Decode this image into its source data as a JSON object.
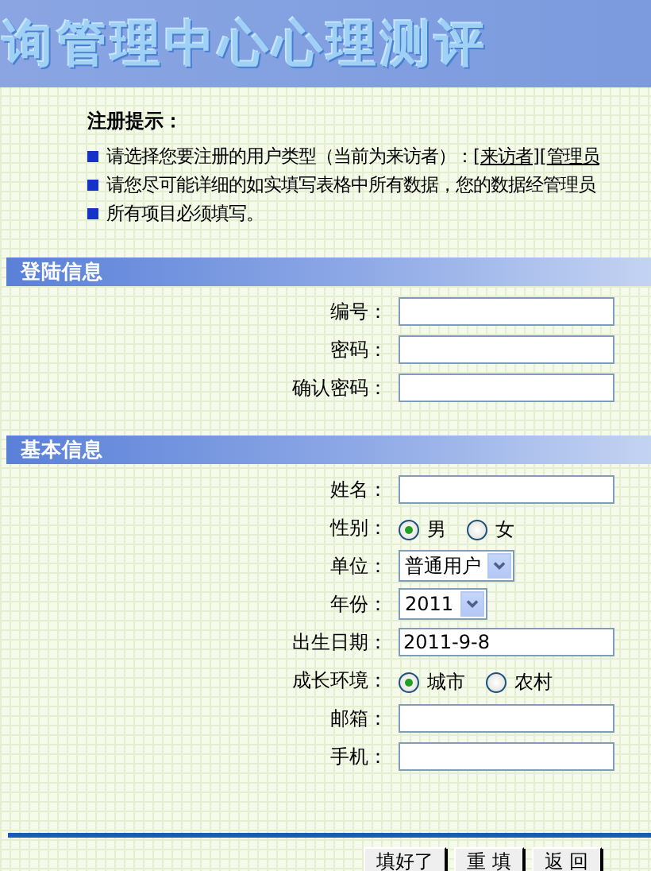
{
  "header": {
    "title": "询管理中心心理测评"
  },
  "tips": {
    "title": "注册提示：",
    "items": [
      {
        "segments": [
          {
            "kind": "text",
            "text": "请选择您要注册的用户类型（当前为来访者）：["
          },
          {
            "kind": "link",
            "text": "来访者"
          },
          {
            "kind": "text",
            "text": "]["
          },
          {
            "kind": "link",
            "text": "管理员"
          }
        ]
      },
      {
        "segments": [
          {
            "kind": "text",
            "text": "请您尽可能详细的如实填写表格中所有数据，您的数据经管理员"
          }
        ]
      },
      {
        "segments": [
          {
            "kind": "text",
            "text": "所有项目必须填写。"
          }
        ]
      }
    ]
  },
  "sections": [
    {
      "title": "登陆信息",
      "fields": [
        {
          "label": "编号：",
          "kind": "text"
        },
        {
          "label": "密码：",
          "kind": "text"
        },
        {
          "label": "确认密码：",
          "kind": "text"
        }
      ]
    },
    {
      "title": "基本信息",
      "fields": [
        {
          "label": "姓名：",
          "kind": "text"
        },
        {
          "label": "性别：",
          "kind": "radio",
          "options": [
            {
              "label": "男",
              "selected": true
            },
            {
              "label": "女",
              "selected": false
            }
          ]
        },
        {
          "label": "单位：",
          "kind": "select",
          "value": "普通用户"
        },
        {
          "label": "年份：",
          "kind": "select",
          "value": "2011"
        },
        {
          "label": "出生日期：",
          "kind": "text",
          "value": "2011-9-8"
        },
        {
          "label": "成长环境：",
          "kind": "radio",
          "options": [
            {
              "label": "城市",
              "selected": true
            },
            {
              "label": "农村",
              "selected": false
            }
          ]
        },
        {
          "label": "邮箱：",
          "kind": "text"
        },
        {
          "label": "手机：",
          "kind": "text"
        }
      ]
    }
  ],
  "buttons": [
    "填好了",
    "重 填",
    "返 回"
  ]
}
